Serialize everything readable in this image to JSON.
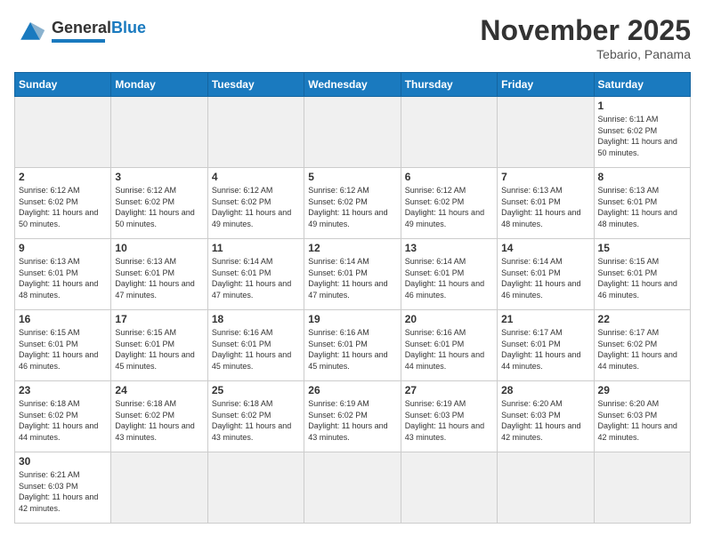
{
  "header": {
    "logo_general": "General",
    "logo_blue": "Blue",
    "month_title": "November 2025",
    "location": "Tebario, Panama"
  },
  "days_of_week": [
    "Sunday",
    "Monday",
    "Tuesday",
    "Wednesday",
    "Thursday",
    "Friday",
    "Saturday"
  ],
  "cells": [
    {
      "day": "",
      "info": ""
    },
    {
      "day": "",
      "info": ""
    },
    {
      "day": "",
      "info": ""
    },
    {
      "day": "",
      "info": ""
    },
    {
      "day": "",
      "info": ""
    },
    {
      "day": "",
      "info": ""
    },
    {
      "day": "1",
      "info": "Sunrise: 6:11 AM\nSunset: 6:02 PM\nDaylight: 11 hours and 50 minutes."
    },
    {
      "day": "2",
      "info": "Sunrise: 6:12 AM\nSunset: 6:02 PM\nDaylight: 11 hours and 50 minutes."
    },
    {
      "day": "3",
      "info": "Sunrise: 6:12 AM\nSunset: 6:02 PM\nDaylight: 11 hours and 50 minutes."
    },
    {
      "day": "4",
      "info": "Sunrise: 6:12 AM\nSunset: 6:02 PM\nDaylight: 11 hours and 49 minutes."
    },
    {
      "day": "5",
      "info": "Sunrise: 6:12 AM\nSunset: 6:02 PM\nDaylight: 11 hours and 49 minutes."
    },
    {
      "day": "6",
      "info": "Sunrise: 6:12 AM\nSunset: 6:02 PM\nDaylight: 11 hours and 49 minutes."
    },
    {
      "day": "7",
      "info": "Sunrise: 6:13 AM\nSunset: 6:01 PM\nDaylight: 11 hours and 48 minutes."
    },
    {
      "day": "8",
      "info": "Sunrise: 6:13 AM\nSunset: 6:01 PM\nDaylight: 11 hours and 48 minutes."
    },
    {
      "day": "9",
      "info": "Sunrise: 6:13 AM\nSunset: 6:01 PM\nDaylight: 11 hours and 48 minutes."
    },
    {
      "day": "10",
      "info": "Sunrise: 6:13 AM\nSunset: 6:01 PM\nDaylight: 11 hours and 47 minutes."
    },
    {
      "day": "11",
      "info": "Sunrise: 6:14 AM\nSunset: 6:01 PM\nDaylight: 11 hours and 47 minutes."
    },
    {
      "day": "12",
      "info": "Sunrise: 6:14 AM\nSunset: 6:01 PM\nDaylight: 11 hours and 47 minutes."
    },
    {
      "day": "13",
      "info": "Sunrise: 6:14 AM\nSunset: 6:01 PM\nDaylight: 11 hours and 46 minutes."
    },
    {
      "day": "14",
      "info": "Sunrise: 6:14 AM\nSunset: 6:01 PM\nDaylight: 11 hours and 46 minutes."
    },
    {
      "day": "15",
      "info": "Sunrise: 6:15 AM\nSunset: 6:01 PM\nDaylight: 11 hours and 46 minutes."
    },
    {
      "day": "16",
      "info": "Sunrise: 6:15 AM\nSunset: 6:01 PM\nDaylight: 11 hours and 46 minutes."
    },
    {
      "day": "17",
      "info": "Sunrise: 6:15 AM\nSunset: 6:01 PM\nDaylight: 11 hours and 45 minutes."
    },
    {
      "day": "18",
      "info": "Sunrise: 6:16 AM\nSunset: 6:01 PM\nDaylight: 11 hours and 45 minutes."
    },
    {
      "day": "19",
      "info": "Sunrise: 6:16 AM\nSunset: 6:01 PM\nDaylight: 11 hours and 45 minutes."
    },
    {
      "day": "20",
      "info": "Sunrise: 6:16 AM\nSunset: 6:01 PM\nDaylight: 11 hours and 44 minutes."
    },
    {
      "day": "21",
      "info": "Sunrise: 6:17 AM\nSunset: 6:01 PM\nDaylight: 11 hours and 44 minutes."
    },
    {
      "day": "22",
      "info": "Sunrise: 6:17 AM\nSunset: 6:02 PM\nDaylight: 11 hours and 44 minutes."
    },
    {
      "day": "23",
      "info": "Sunrise: 6:18 AM\nSunset: 6:02 PM\nDaylight: 11 hours and 44 minutes."
    },
    {
      "day": "24",
      "info": "Sunrise: 6:18 AM\nSunset: 6:02 PM\nDaylight: 11 hours and 43 minutes."
    },
    {
      "day": "25",
      "info": "Sunrise: 6:18 AM\nSunset: 6:02 PM\nDaylight: 11 hours and 43 minutes."
    },
    {
      "day": "26",
      "info": "Sunrise: 6:19 AM\nSunset: 6:02 PM\nDaylight: 11 hours and 43 minutes."
    },
    {
      "day": "27",
      "info": "Sunrise: 6:19 AM\nSunset: 6:03 PM\nDaylight: 11 hours and 43 minutes."
    },
    {
      "day": "28",
      "info": "Sunrise: 6:20 AM\nSunset: 6:03 PM\nDaylight: 11 hours and 42 minutes."
    },
    {
      "day": "29",
      "info": "Sunrise: 6:20 AM\nSunset: 6:03 PM\nDaylight: 11 hours and 42 minutes."
    },
    {
      "day": "30",
      "info": "Sunrise: 6:21 AM\nSunset: 6:03 PM\nDaylight: 11 hours and 42 minutes."
    },
    {
      "day": "",
      "info": ""
    },
    {
      "day": "",
      "info": ""
    },
    {
      "day": "",
      "info": ""
    },
    {
      "day": "",
      "info": ""
    },
    {
      "day": "",
      "info": ""
    },
    {
      "day": "",
      "info": ""
    }
  ]
}
